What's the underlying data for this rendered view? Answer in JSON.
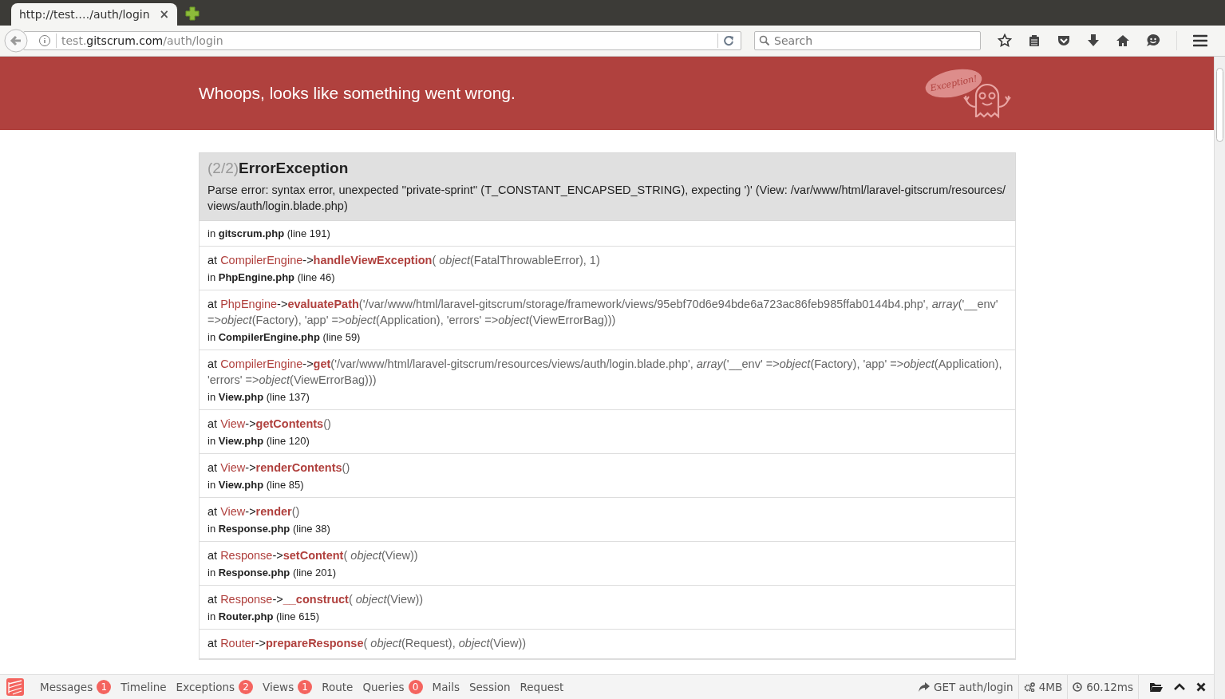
{
  "browser": {
    "tab": {
      "title": "http://test.…/auth/login",
      "close": "×"
    },
    "address": {
      "prefix": "test.",
      "domain": "gitscrum.com",
      "path": "/auth/login"
    },
    "search": {
      "placeholder": "Search"
    }
  },
  "header": {
    "message": "Whoops, looks like something went wrong.",
    "logo_text": "Exception!"
  },
  "exception": {
    "counter": "(2/2)",
    "title": "ErrorException",
    "message": "Parse error: syntax error, unexpected ''private-sprint'' (T_CONSTANT_ENCAPSED_STRING), expecting ')' (View: /var/www/html/laravel-gitscrum/resources/views/auth/login.blade.php)",
    "location": "in **gitscrum.php** (line 191)"
  },
  "frames": [
    {
      "lead": "at",
      "class": "CompilerEngine",
      "arrow": "->",
      "method": "handleViewException",
      "args": "( *object*(FatalThrowableError), 1)",
      "location": "in **PhpEngine.php** (line 46)"
    },
    {
      "lead": "at",
      "class": "PhpEngine",
      "arrow": "->",
      "method": "evaluatePath",
      "args": "('/var/www/html/laravel-gitscrum/storage/framework/views/95ebf70d6e94bde6a723ac86feb985ffab0144b4.php', *array*('__env' =>*object*(Factory), 'app' =>*object*(Application), 'errors' =>*object*(ViewErrorBag)))",
      "location": "in **CompilerEngine.php** (line 59)"
    },
    {
      "lead": "at",
      "class": "CompilerEngine",
      "arrow": "->",
      "method": "get",
      "args": "('/var/www/html/laravel-gitscrum/resources/views/auth/login.blade.php', *array*('__env' =>*object*(Factory), 'app' =>*object*(Application), 'errors' =>*object*(ViewErrorBag)))",
      "location": "in **View.php** (line 137)"
    },
    {
      "lead": "at",
      "class": "View",
      "arrow": "->",
      "method": "getContents",
      "args": "()",
      "location": "in **View.php** (line 120)"
    },
    {
      "lead": "at",
      "class": "View",
      "arrow": "->",
      "method": "renderContents",
      "args": "()",
      "location": "in **View.php** (line 85)"
    },
    {
      "lead": "at",
      "class": "View",
      "arrow": "->",
      "method": "render",
      "args": "()",
      "location": "in **Response.php** (line 38)"
    },
    {
      "lead": "at",
      "class": "Response",
      "arrow": "->",
      "method": "setContent",
      "args": "( *object*(View))",
      "location": "in **Response.php** (line 201)"
    },
    {
      "lead": "at",
      "class": "Response",
      "arrow": "->",
      "method": "__construct",
      "args": "( *object*(View))",
      "location": "in **Router.php** (line 615)"
    },
    {
      "lead": "at",
      "class": "Router",
      "arrow": "->",
      "method": "prepareResponse",
      "args": "( *object*(Request), *object*(View))"
    }
  ],
  "debugbar": {
    "tabs": [
      {
        "label": "Messages",
        "badge": "1"
      },
      {
        "label": "Timeline"
      },
      {
        "label": "Exceptions",
        "badge": "2"
      },
      {
        "label": "Views",
        "badge": "1"
      },
      {
        "label": "Route"
      },
      {
        "label": "Queries",
        "badge": "0"
      },
      {
        "label": "Mails"
      },
      {
        "label": "Session"
      },
      {
        "label": "Request"
      }
    ],
    "request": "GET auth/login",
    "memory": "4MB",
    "time": "60.12ms"
  }
}
